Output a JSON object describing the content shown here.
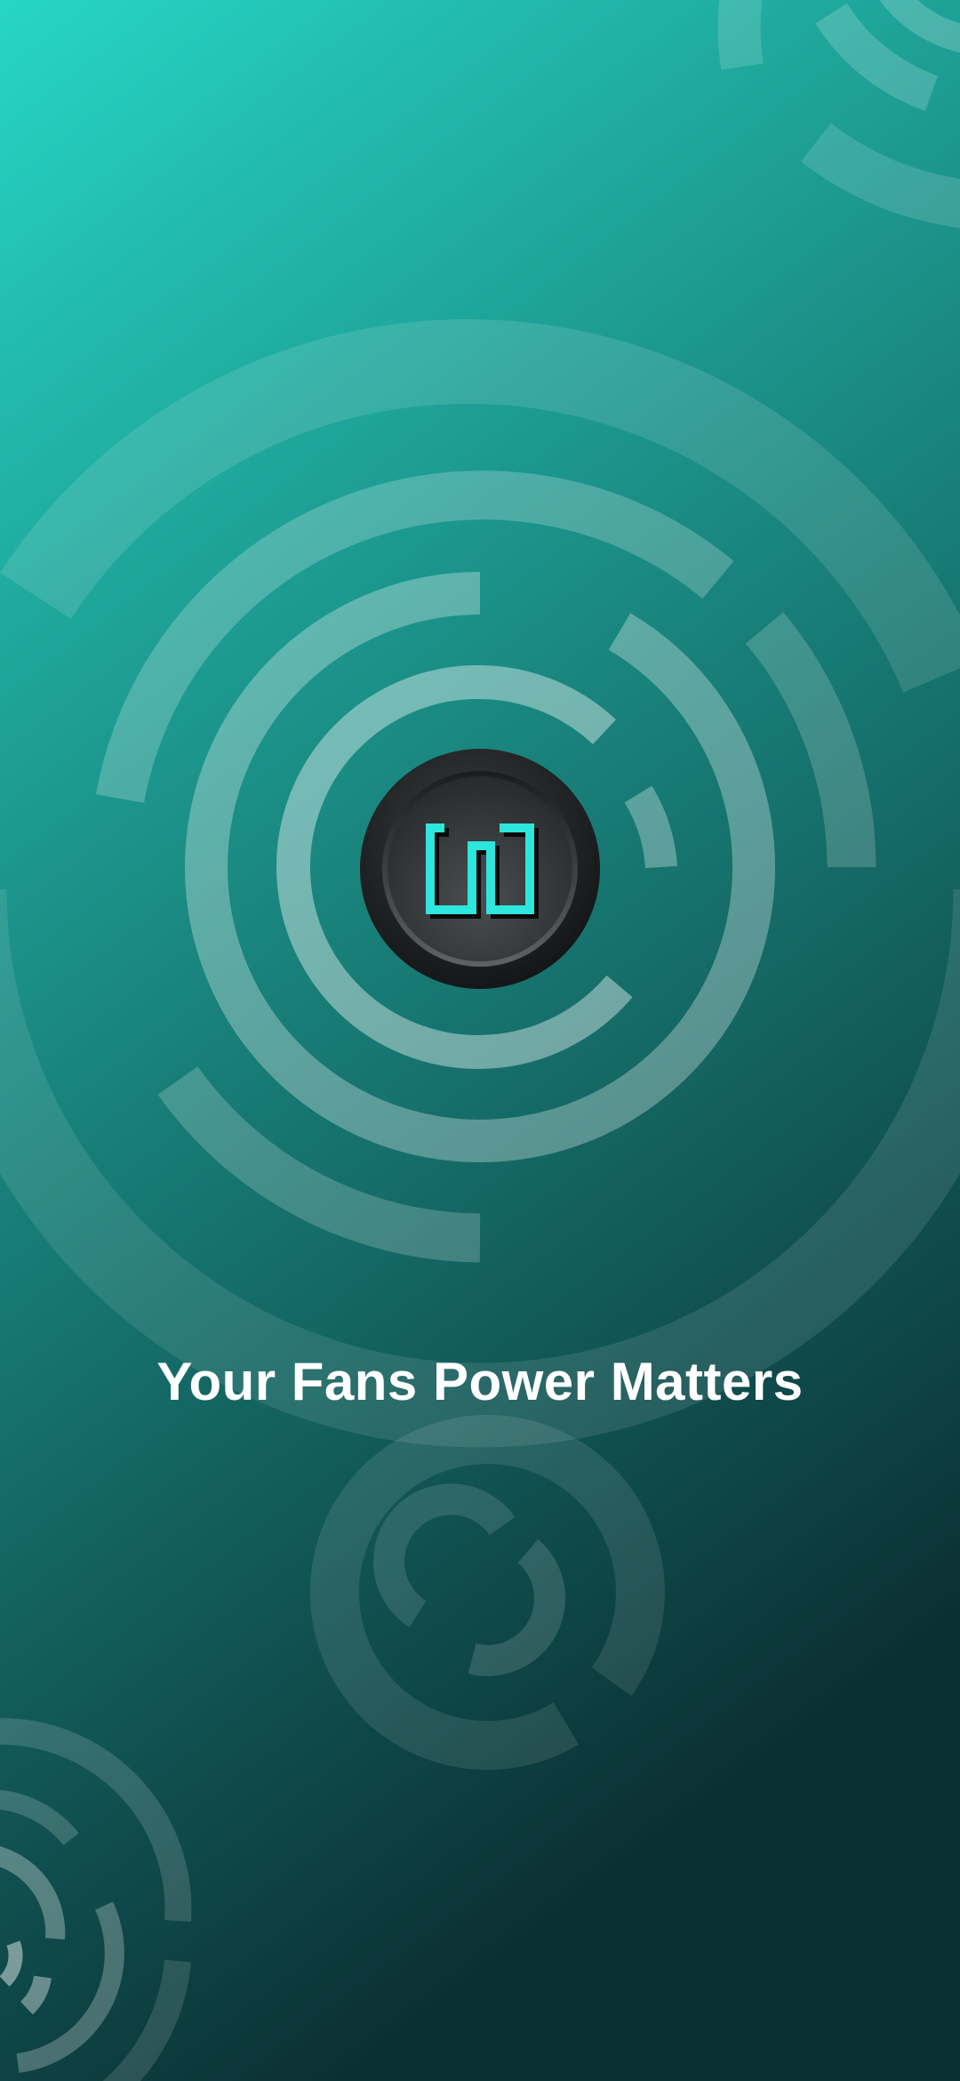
{
  "splash": {
    "tagline": "Your Fans Power Matters",
    "logo_icon": "meander-square-logo-icon"
  },
  "colors": {
    "gradient_top": "#27d6c6",
    "gradient_mid": "#1a8a82",
    "gradient_bottom": "#0b3034",
    "accent": "#2de6dc",
    "ring": "#ffffff",
    "text": "#ffffff"
  }
}
